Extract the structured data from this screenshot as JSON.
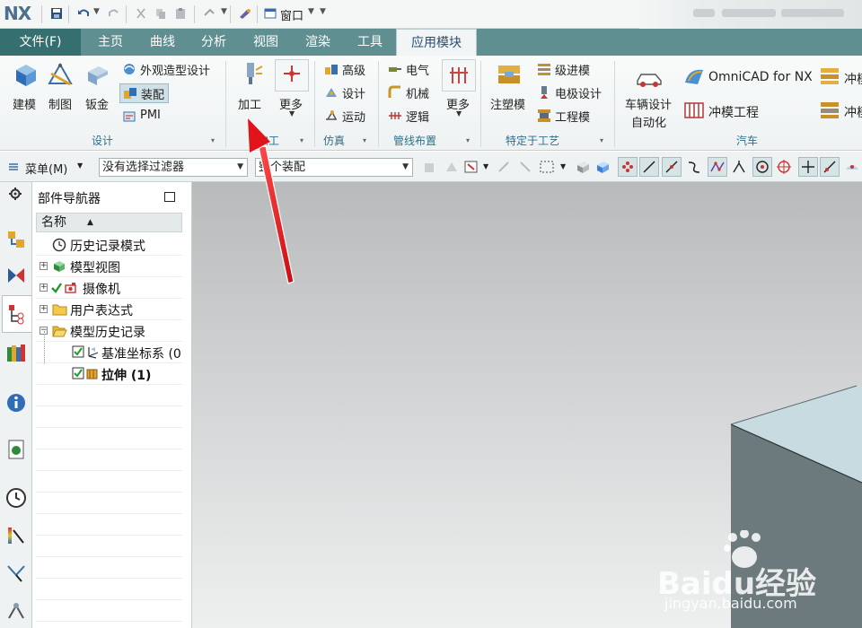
{
  "app": {
    "logo": "NX",
    "quick_access_window": "窗口"
  },
  "tabs": {
    "file": "文件(F)",
    "items": [
      "主页",
      "曲线",
      "分析",
      "视图",
      "渲染",
      "工具",
      "应用模块"
    ],
    "active": "应用模块"
  },
  "ribbon": {
    "design": {
      "group_label": "设计",
      "build": "建模",
      "drafting": "制图",
      "sheet_metal": "钣金",
      "appearance": "外观造型设计",
      "assembly": "装配",
      "pmi": "PMI"
    },
    "machining": {
      "group_label": "加工",
      "machining": "加工",
      "more": "更多"
    },
    "simulation": {
      "group_label": "仿真",
      "advanced": "高级",
      "design": "设计",
      "motion": "运动"
    },
    "routing": {
      "group_label": "管线布置",
      "electrical": "电气",
      "mechanical": "机械",
      "logical": "逻辑",
      "more": "更多"
    },
    "process": {
      "group_label": "特定于工艺",
      "mold": "注塑模",
      "progressive_die": "级进模",
      "electrode": "电极设计",
      "engineering_die": "工程模"
    },
    "auto": {
      "group_label": "汽车",
      "vehicle_design_line1": "车辆设计",
      "vehicle_design_line2": "自动化",
      "omnicad": "OmniCAD for NX",
      "stamping_engineering": "冲模工程",
      "stamp_cut1": "冲模",
      "stamp_cut2": "冲模"
    }
  },
  "commandbar": {
    "menu": "菜单(M)",
    "filter": "没有选择过滤器",
    "scope": "整个装配"
  },
  "navigator": {
    "title": "部件导航器",
    "column": "名称",
    "items": [
      {
        "label": "历史记录模式"
      },
      {
        "label": "模型视图"
      },
      {
        "label": "摄像机"
      },
      {
        "label": "用户表达式"
      },
      {
        "label": "模型历史记录"
      },
      {
        "label": "基准坐标系 (0"
      },
      {
        "label": "拉伸 (1)"
      }
    ]
  },
  "watermark": {
    "brand": "Baidu经验",
    "url": "jingyan.baidu.com"
  },
  "colors": {
    "tab_bar": "#5f8f90",
    "file_tab": "#356f70",
    "accent_text": "#2b4d70",
    "arrow": "#e0141a"
  }
}
